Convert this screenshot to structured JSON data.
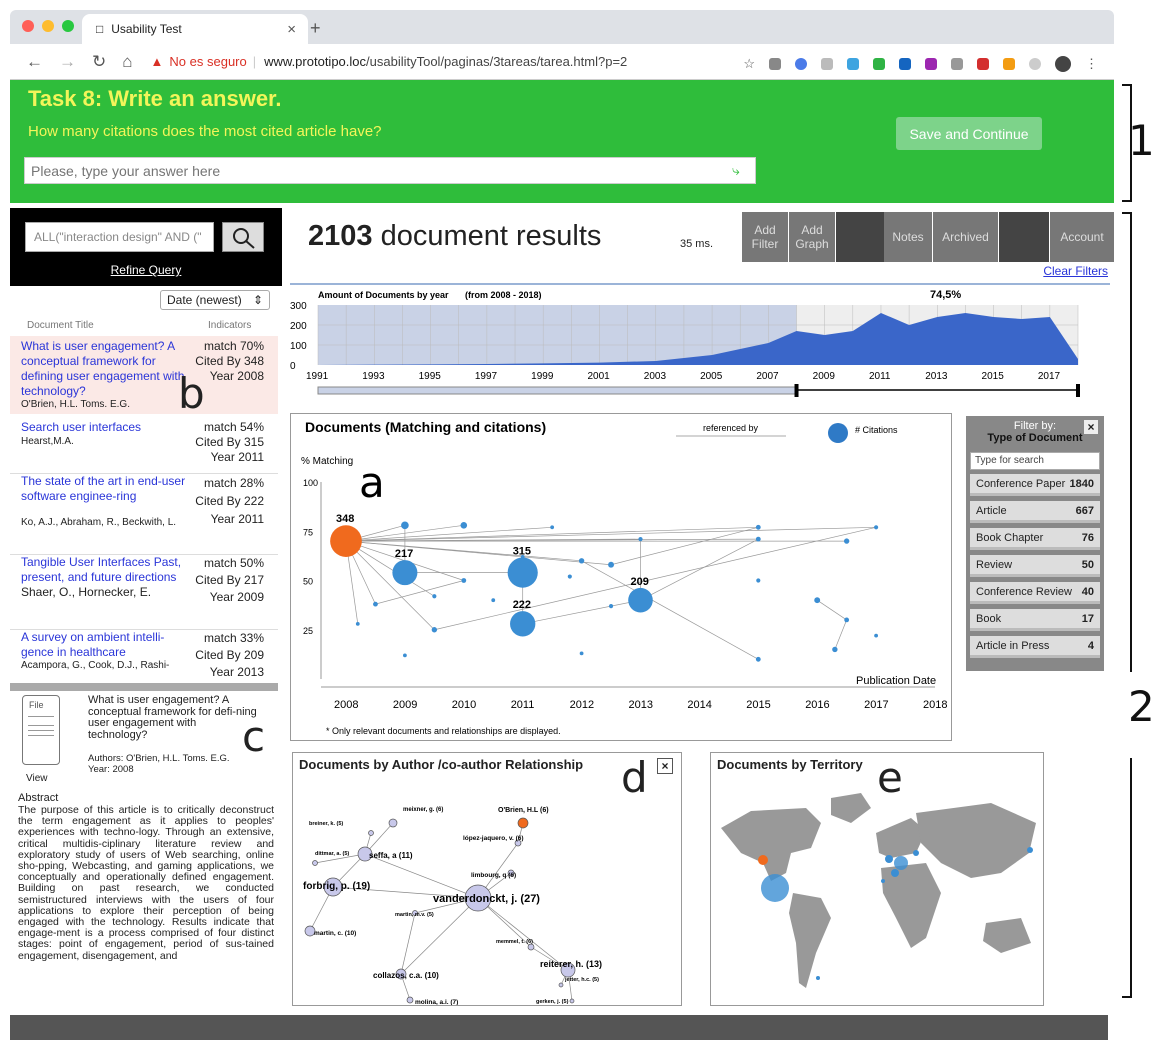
{
  "browser": {
    "tab_title": "Usability Test",
    "warning": "No es seguro",
    "url_host": "www.prototipo.loc",
    "url_path": "/usabilityTool/paginas/3tareas/tarea.html?p=2"
  },
  "task": {
    "title": "Task 8: Write an answer.",
    "question": "How many citations does the most cited article have?",
    "placeholder": "Please, type your answer here",
    "save_label": "Save and Continue"
  },
  "markers": {
    "one": "1",
    "two": "2",
    "a": "a",
    "b": "b",
    "c": "c",
    "d": "d",
    "e": "e"
  },
  "sidebar": {
    "query": "ALL(\"interaction design\" AND (\"",
    "refine": "Refine Query",
    "sort": "Date (newest)",
    "col_title": "Document Title",
    "col_indicators": "Indicators",
    "docs": [
      {
        "title": "What is user engagement? A conceptual framework for defining user engagement with technology?",
        "authors": "O'Brien, H.L. Toms. E.G.",
        "match": "match  70%",
        "cited": "Cited By 348",
        "year": "Year 2008"
      },
      {
        "title": "Search user interfaces",
        "authors": "Hearst,M.A.",
        "match": "match  54%",
        "cited": "Cited By  315",
        "year": "Year 2011"
      },
      {
        "title": "The state of the art in end-user software enginee-ring",
        "authors": "Ko, A.J., Abraham, R., Beckwith, L.",
        "match": "match  28%",
        "cited": "Cited By  222",
        "year": "Year 2011"
      },
      {
        "title": "Tangible User Interfaces Past, present, and future directions",
        "authors": "Shaer, O., Hornecker, E.",
        "match": "match  50%",
        "cited": "Cited By  217",
        "year": "Year 2009"
      },
      {
        "title": "A survey on ambient intelli-gence in healthcare",
        "authors": "Acampora, G., Cook, D.J., Rashi-",
        "match": "match  33%",
        "cited": "Cited By  209",
        "year": "Year 2013"
      }
    ],
    "detail": {
      "file": "File",
      "view": "View",
      "title": "What is user engagement? A conceptual framework for defi-ning user engagement with technology?",
      "authors": "Authors: O'Brien, H.L. Toms. E.G.",
      "year": "Year:  2008",
      "abstract_heading": "Abstract",
      "abstract": "The purpose of this article is to critically deconstruct the term engagement as it applies to peoples' experiences with techno-logy. Through an extensive, critical multidis-ciplinary literature review and exploratory study of users of Web searching, online sho-pping, Webcasting, and gaming applications, we conceptually and operationally defined engagement. Building on past research, we conducted semistructured interviews with the users of four applications to explore their perception of being engaged with the technology. Results indicate that engage-ment is a process comprised of four distinct stages: point of engagement, period of sus-tained engagement, disengagement, and"
    }
  },
  "topbar": {
    "count": "2103",
    "count_label": " document results",
    "ms": "35 ms.",
    "buttons": [
      "Add Filter",
      "Add Graph",
      "",
      "Notes",
      "Archived",
      "",
      "Account"
    ],
    "clear": "Clear Filters"
  },
  "timeline": {
    "title": "Amount of Documents by year",
    "range": "(from 2008 - 2018)",
    "pct": "74,5%",
    "yticks": [
      "300",
      "200",
      "100",
      "0"
    ],
    "xticks": [
      "1991",
      "1993",
      "1995",
      "1997",
      "1999",
      "2001",
      "2003",
      "2005",
      "2007",
      "2009",
      "2011",
      "2013",
      "2015",
      "2017"
    ]
  },
  "scatter": {
    "title": "Documents (Matching and citations)",
    "referenced": "referenced by",
    "citations": "# Citations",
    "ylabel": "% Matching",
    "xlabel": "Publication Date",
    "note": "* Only relevant documents and relationships are displayed.",
    "yticks": [
      "100",
      "75",
      "50",
      "25"
    ],
    "xticks": [
      "2008",
      "2009",
      "2010",
      "2011",
      "2012",
      "2013",
      "2014",
      "2015",
      "2016",
      "2017",
      "2018"
    ],
    "labels": [
      "348",
      "217",
      "315",
      "222",
      "209"
    ]
  },
  "chart_data": [
    {
      "type": "area",
      "title": "Amount of Documents by year",
      "subtitle": "(from 2008 - 2018)",
      "x": [
        1991,
        1993,
        1995,
        1997,
        1999,
        2001,
        2003,
        2005,
        2006,
        2007,
        2008,
        2009,
        2010,
        2011,
        2012,
        2013,
        2014,
        2015,
        2016,
        2017,
        2018
      ],
      "values": [
        0,
        2,
        3,
        5,
        8,
        12,
        20,
        50,
        80,
        110,
        170,
        150,
        170,
        260,
        200,
        240,
        260,
        240,
        230,
        240,
        30
      ],
      "ylim": [
        0,
        300
      ],
      "selection": "74,5%"
    },
    {
      "type": "scatter",
      "title": "Documents (Matching and citations)",
      "xlabel": "Publication Date",
      "ylabel": "% Matching",
      "xlim": [
        2008,
        2018
      ],
      "ylim": [
        0,
        100
      ],
      "points": [
        {
          "x": 2008,
          "y": 70,
          "cites": 348,
          "label": "348",
          "highlight": true
        },
        {
          "x": 2009,
          "y": 54,
          "cites": 217,
          "label": "217"
        },
        {
          "x": 2011,
          "y": 54,
          "cites": 315,
          "label": "315"
        },
        {
          "x": 2011,
          "y": 28,
          "cites": 222,
          "label": "222"
        },
        {
          "x": 2013,
          "y": 40,
          "cites": 209,
          "label": "209"
        },
        {
          "x": 2009,
          "y": 78,
          "cites": 20
        },
        {
          "x": 2010,
          "y": 78,
          "cites": 15
        },
        {
          "x": 2011.5,
          "y": 77,
          "cites": 5
        },
        {
          "x": 2015,
          "y": 77,
          "cites": 8
        },
        {
          "x": 2017,
          "y": 77,
          "cites": 6
        },
        {
          "x": 2016.5,
          "y": 70,
          "cites": 10
        },
        {
          "x": 2015,
          "y": 71,
          "cites": 8
        },
        {
          "x": 2013,
          "y": 71,
          "cites": 6
        },
        {
          "x": 2012,
          "y": 60,
          "cites": 10
        },
        {
          "x": 2012.5,
          "y": 58,
          "cites": 12
        },
        {
          "x": 2010,
          "y": 50,
          "cites": 8
        },
        {
          "x": 2008.5,
          "y": 38,
          "cites": 8
        },
        {
          "x": 2009.5,
          "y": 42,
          "cites": 6
        },
        {
          "x": 2009.5,
          "y": 25,
          "cites": 10
        },
        {
          "x": 2008.2,
          "y": 28,
          "cites": 5
        },
        {
          "x": 2016,
          "y": 40,
          "cites": 12
        },
        {
          "x": 2016.5,
          "y": 30,
          "cites": 8
        },
        {
          "x": 2016.3,
          "y": 15,
          "cites": 10
        },
        {
          "x": 2015,
          "y": 10,
          "cites": 8
        },
        {
          "x": 2015,
          "y": 50,
          "cites": 6
        },
        {
          "x": 2017,
          "y": 22,
          "cites": 5
        },
        {
          "x": 2012.5,
          "y": 37,
          "cites": 6
        },
        {
          "x": 2011,
          "y": 62,
          "cites": 5
        },
        {
          "x": 2010.5,
          "y": 40,
          "cites": 5
        },
        {
          "x": 2012,
          "y": 13,
          "cites": 5
        },
        {
          "x": 2009,
          "y": 12,
          "cites": 5
        },
        {
          "x": 2011.8,
          "y": 52,
          "cites": 6
        }
      ]
    }
  ],
  "filter": {
    "title": "Filter by:",
    "subtitle": "Type of Document",
    "search": "Type for search",
    "items": [
      {
        "label": "Conference Paper",
        "count": "1840"
      },
      {
        "label": "Article",
        "count": "667"
      },
      {
        "label": "Book Chapter",
        "count": "76"
      },
      {
        "label": "Review",
        "count": "50"
      },
      {
        "label": "Conference Review",
        "count": "40"
      },
      {
        "label": "Book",
        "count": "17"
      },
      {
        "label": "Article in Press",
        "count": "4"
      }
    ]
  },
  "authors": {
    "title": "Documents by Author /co-author Relationship",
    "nodes": [
      "meixner, g. (6)",
      "breiner, k. (5)",
      "O'Brien, H.L (6)",
      "lópez-jaquero, v. (6)",
      "dittmar, a. (5)",
      "seffa, a (11)",
      "limbourg, q (6)",
      "forbrig, p. (19)",
      "vanderdonckt, j. (27)",
      "martin, m.v. (5)",
      "martin, c. (10)",
      "memmel, t. (6)",
      "collazos, c.a. (10)",
      "reiterer, h. (13)",
      "jetter, h.c. (5)",
      "gerken, j. (5)",
      "molina, a.i. (7)"
    ]
  },
  "territory": {
    "title": "Documents by Territory"
  }
}
